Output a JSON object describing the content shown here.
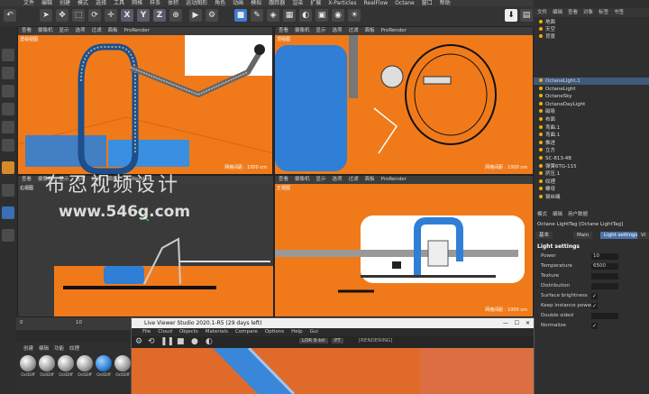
{
  "menubar": [
    "文件",
    "编辑",
    "创建",
    "模式",
    "选择",
    "工具",
    "网格",
    "样条",
    "体积",
    "运动图形",
    "角色",
    "动画",
    "模拟",
    "跟踪器",
    "渲染",
    "扩展",
    "X-Particles",
    "RealFlow",
    "Octane",
    "窗口",
    "帮助"
  ],
  "toolbar": {
    "x": "X",
    "y": "Y",
    "z": "Z"
  },
  "viewports": [
    {
      "label": "透视视图",
      "menu": [
        "查看",
        "摄像机",
        "显示",
        "选项",
        "过滤",
        "面板",
        "ProRender"
      ],
      "info": "网格间距 : 1000 cm"
    },
    {
      "label": "顶视图",
      "menu": [
        "查看",
        "摄像机",
        "显示",
        "选项",
        "过滤",
        "面板",
        "ProRender"
      ],
      "info": "网格间距 : 1000 cm"
    },
    {
      "label": "右视图",
      "menu": [
        "查看",
        "摄像机",
        "显示",
        "选项",
        "过滤",
        "面板",
        "ProRender"
      ],
      "info": ""
    },
    {
      "label": "正视图",
      "menu": [
        "查看",
        "摄像机",
        "显示",
        "选项",
        "过滤",
        "面板",
        "ProRender"
      ],
      "info": "网格间距 : 1000 cm"
    }
  ],
  "objmgr": {
    "menu": [
      "文件",
      "编辑",
      "查看",
      "对象",
      "标签",
      "书签"
    ],
    "top_rows": [
      "地面",
      "天空",
      "背景"
    ],
    "rows": [
      "OctaneLight.1",
      "OctaneLight",
      "OctaneSky",
      "OctaneDayLight",
      "磁吸",
      "布面",
      "弯曲.1",
      "弯曲.1",
      "推进",
      "立方",
      "SC-813-4B",
      "弹簧6TG-115",
      "挤压.1",
      "纹理",
      "螺母",
      "钢丝绳"
    ],
    "selected_index": 0
  },
  "attrs": {
    "menu": [
      "模式",
      "编辑",
      "用户数据"
    ],
    "title": "Octane LightTag [Octane LightTag]",
    "tabs": [
      "基本",
      "Main",
      "Light settings",
      "Vi"
    ],
    "active_tab": 2,
    "section": "Light settings",
    "rows": [
      {
        "label": "Power",
        "value": "10"
      },
      {
        "label": "Temperature",
        "value": "6500"
      },
      {
        "label": "Texture",
        "value": ""
      },
      {
        "label": "Distribution",
        "value": ""
      },
      {
        "label": "Surface brightness",
        "value": "✓"
      },
      {
        "label": "Keep instance power",
        "value": "✓"
      },
      {
        "label": "Double sided",
        "value": ""
      },
      {
        "label": "Normalize",
        "value": "✓"
      }
    ]
  },
  "timeline": {
    "ticks": [
      "0",
      "10",
      "20",
      "30",
      "40",
      "50",
      "60",
      "70",
      "80",
      "90"
    ]
  },
  "matmgr": {
    "menu": [
      "创建",
      "编辑",
      "功能",
      "纹理"
    ],
    "materials": [
      "OctDiff",
      "OctDiff",
      "OctDiff",
      "OctDiff",
      "OctDiff",
      "OctDiff"
    ]
  },
  "octane": {
    "title": "Live Viewer Studio 2020.1-R5 (29 days left)",
    "menu": [
      "File",
      "Cloud",
      "Objects",
      "Materials",
      "Compare",
      "Options",
      "Help",
      "Gui"
    ],
    "status": "[RENDERING]",
    "dropdown1": "LDR 8-bit",
    "dropdown2": "PT"
  },
  "watermark": {
    "line1": "布忍视频设计",
    "line2": "www.546g.com"
  }
}
